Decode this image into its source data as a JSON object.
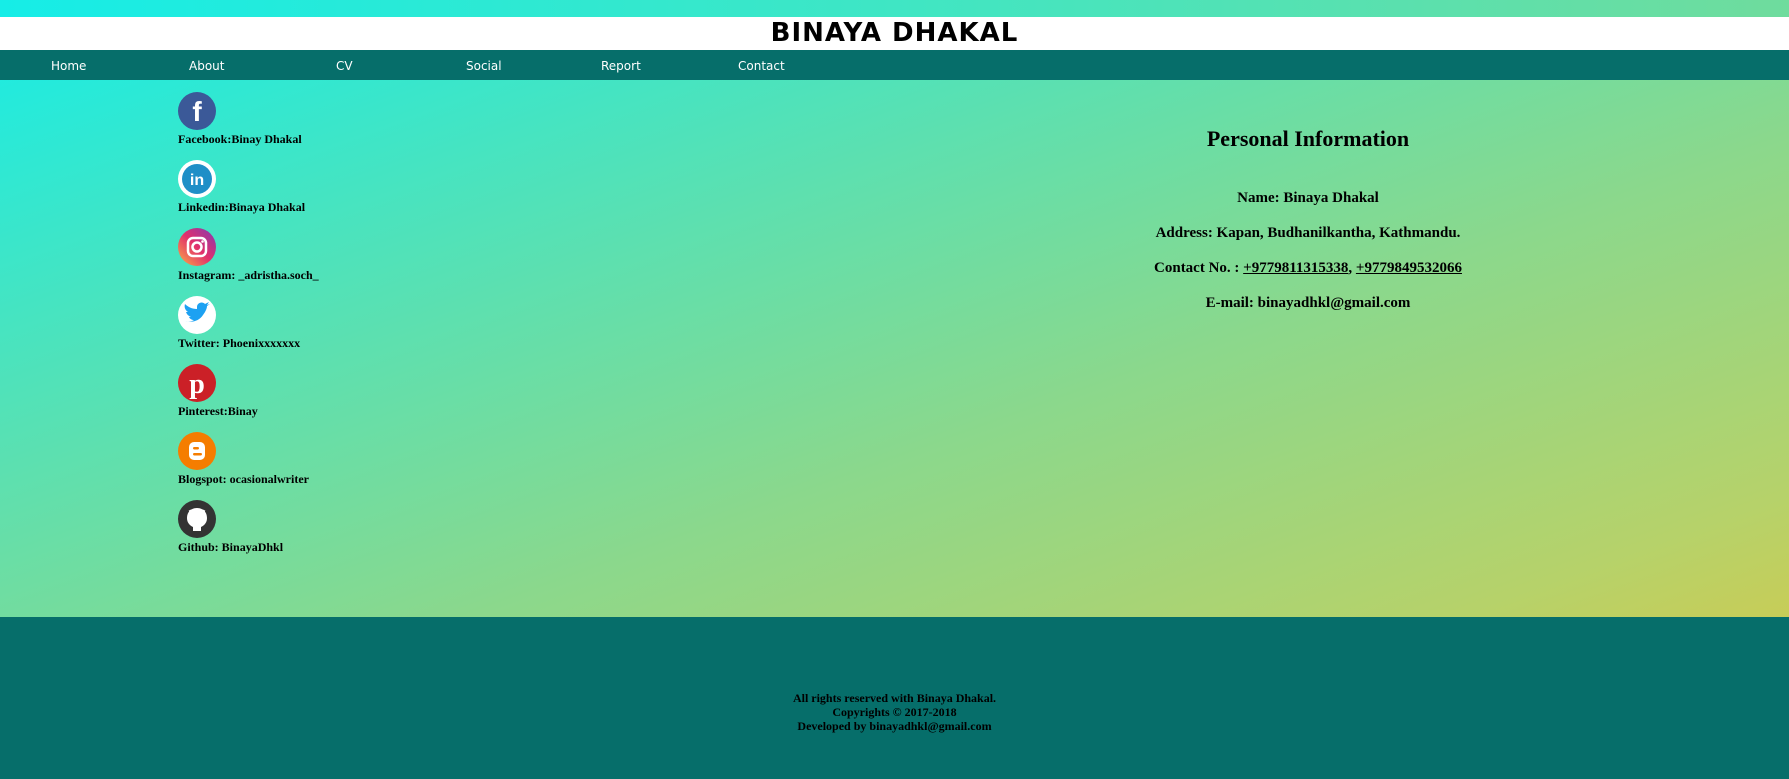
{
  "site": {
    "title": "BINAYA DHAKAL"
  },
  "nav": {
    "items": [
      {
        "label": "Home"
      },
      {
        "label": "About"
      },
      {
        "label": "CV"
      },
      {
        "label": "Social"
      },
      {
        "label": "Report"
      },
      {
        "label": "Contact"
      }
    ]
  },
  "social": {
    "items": [
      {
        "icon": "facebook-icon",
        "label": "Facebook:Binay Dhakal",
        "color": "#3b5998"
      },
      {
        "icon": "linkedin-icon",
        "label": "Linkedin:Binaya Dhakal",
        "color": "#1f8fc7"
      },
      {
        "icon": "instagram-icon",
        "label": "Instagram: _adristha.soch_",
        "color": "#c13584"
      },
      {
        "icon": "twitter-icon",
        "label": "Twitter: Phoenixxxxxxx",
        "color": "#1da1f2"
      },
      {
        "icon": "pinterest-icon",
        "label": "Pinterest:Binay",
        "color": "#cb2027"
      },
      {
        "icon": "blogger-icon",
        "label": "Blogspot: ocasionalwriter",
        "color": "#f57d00"
      },
      {
        "icon": "github-icon",
        "label": "Github: BinayaDhkl",
        "color": "#333333"
      }
    ]
  },
  "info": {
    "heading": "Personal Information",
    "name": "Name: Binaya Dhakal",
    "address": "Address: Kapan, Budhanilkantha, Kathmandu.",
    "contact_prefix": "Contact No. : ",
    "phone1": "+9779811315338",
    "separator": ", ",
    "phone2": "+9779849532066",
    "email": "E-mail: binayadhkl@gmail.com"
  },
  "footer": {
    "line1": "All rights reserved with Binaya Dhakal.",
    "line2": "Copyrights © 2017-2018",
    "line3": "Developed by binayadhkl@gmail.com"
  },
  "colors": {
    "nav_bg": "#066e6a",
    "footer_bg": "#066e6a"
  }
}
